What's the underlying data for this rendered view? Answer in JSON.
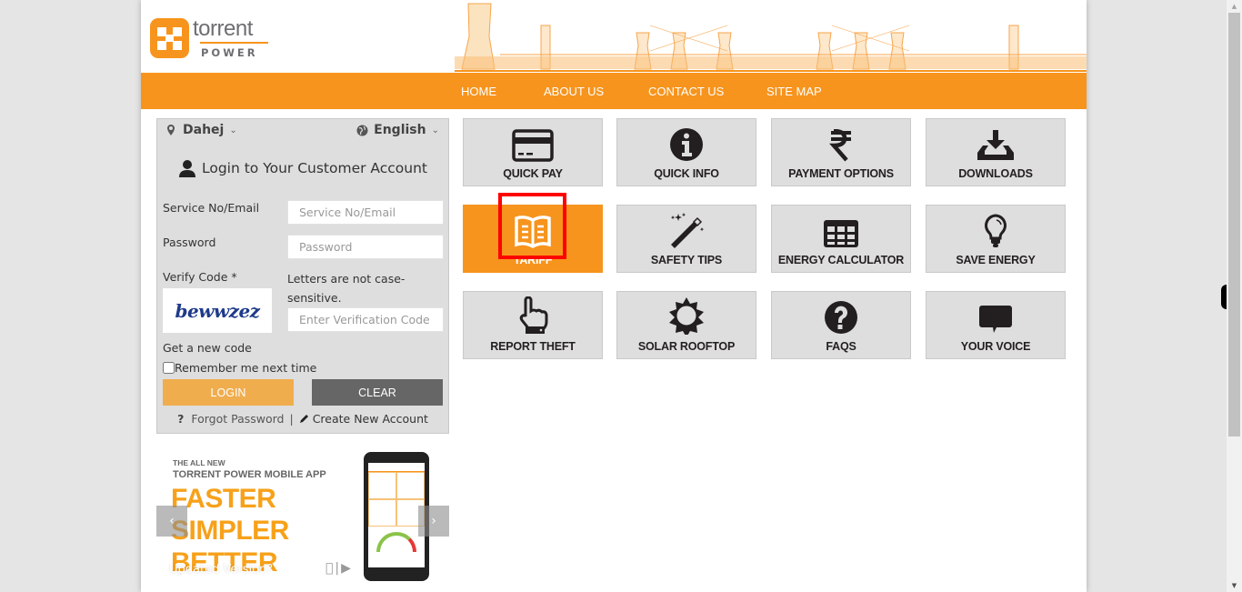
{
  "header": {
    "logo_word": "torrent",
    "logo_sub": "POWER"
  },
  "nav": {
    "items": [
      {
        "label": "HOME"
      },
      {
        "label": "ABOUT US"
      },
      {
        "label": "CONTACT US"
      },
      {
        "label": "SITE MAP"
      }
    ]
  },
  "login": {
    "location": "Dahej",
    "language": "English",
    "title": "Login to Your Customer Account",
    "service_label": "Service No/Email",
    "service_placeholder": "Service No/Email",
    "password_label": "Password",
    "password_placeholder": "Password",
    "verify_label": "Verify Code *",
    "case_hint": "Letters are not case-sensitive.",
    "captcha_text": "bewwzez",
    "verify_placeholder": "Enter Verification Code",
    "new_code": "Get a new code",
    "remember": "Remember me next time",
    "login_button": "LOGIN",
    "clear_button": "CLEAR",
    "forgot_icon": "?",
    "forgot": "Forgot Password",
    "separator": "|",
    "create": "Create New Account"
  },
  "banner": {
    "line1": "THE ALL NEW",
    "line2": "TORRENT POWER MOBILE APP",
    "big1": "FASTER",
    "big2": "SIMPLER",
    "big3": "BETTER",
    "caption": "Updated Version?",
    "prev": "‹",
    "next": "›"
  },
  "tiles": [
    {
      "label": "QUICK PAY",
      "icon": "credit-card-icon"
    },
    {
      "label": "QUICK INFO",
      "icon": "info-icon"
    },
    {
      "label": "PAYMENT OPTIONS",
      "icon": "rupee-icon"
    },
    {
      "label": "DOWNLOADS",
      "icon": "download-icon"
    },
    {
      "label": "TARIFF",
      "icon": "book-icon",
      "active": true
    },
    {
      "label": "SAFETY TIPS",
      "icon": "magic-wand-icon"
    },
    {
      "label": "ENERGY CALCULATOR",
      "icon": "table-grid-icon"
    },
    {
      "label": "SAVE ENERGY",
      "icon": "lightbulb-icon"
    },
    {
      "label": "REPORT THEFT",
      "icon": "hand-pointer-icon"
    },
    {
      "label": "SOLAR ROOFTOP",
      "icon": "sun-icon"
    },
    {
      "label": "FAQS",
      "icon": "question-circle-icon"
    },
    {
      "label": "YOUR VOICE",
      "icon": "comment-icon"
    }
  ],
  "colors": {
    "brand_orange": "#f7941d",
    "login_button": "#f0ad4e",
    "clear_button": "#666666",
    "tile_bg": "#dedede",
    "highlight": "#ff0000"
  }
}
